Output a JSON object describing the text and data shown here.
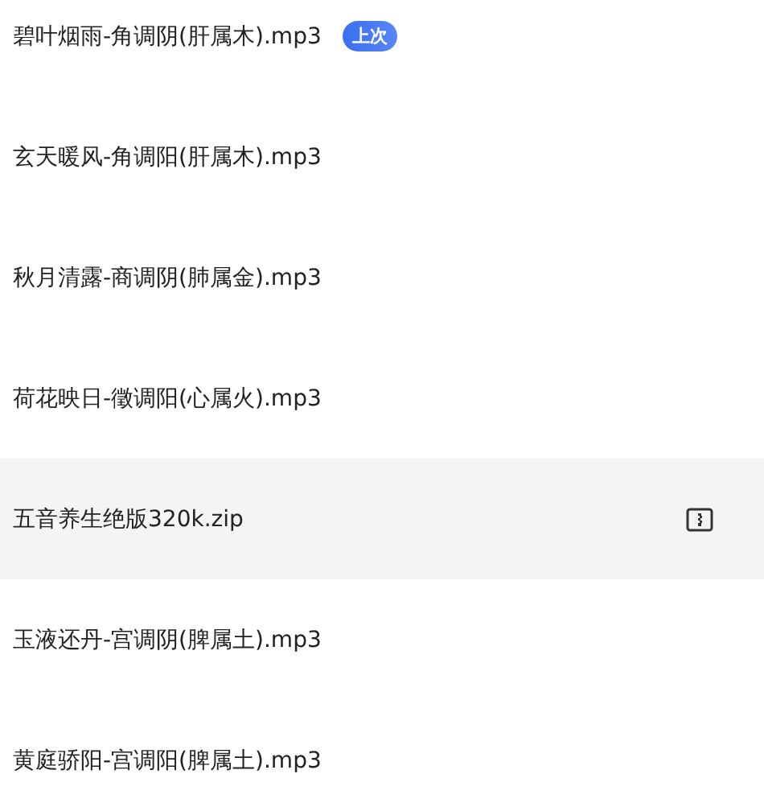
{
  "files": [
    {
      "name": "碧叶烟雨-角调阴(肝属木).mp3",
      "kind": "audio",
      "selected": false,
      "badge": "上次"
    },
    {
      "name": "玄天暖风-角调阳(肝属木).mp3",
      "kind": "audio",
      "selected": false
    },
    {
      "name": "秋月清露-商调阴(肺属金).mp3",
      "kind": "audio",
      "selected": false
    },
    {
      "name": "荷花映日-徵调阳(心属火).mp3",
      "kind": "audio",
      "selected": false
    },
    {
      "name": "五音养生绝版320k.zip",
      "kind": "archive",
      "selected": true
    },
    {
      "name": "玉液还丹-宫调阴(脾属土).mp3",
      "kind": "audio",
      "selected": false
    },
    {
      "name": "黄庭骄阳-宫调阳(脾属土).mp3",
      "kind": "audio",
      "selected": false
    }
  ]
}
